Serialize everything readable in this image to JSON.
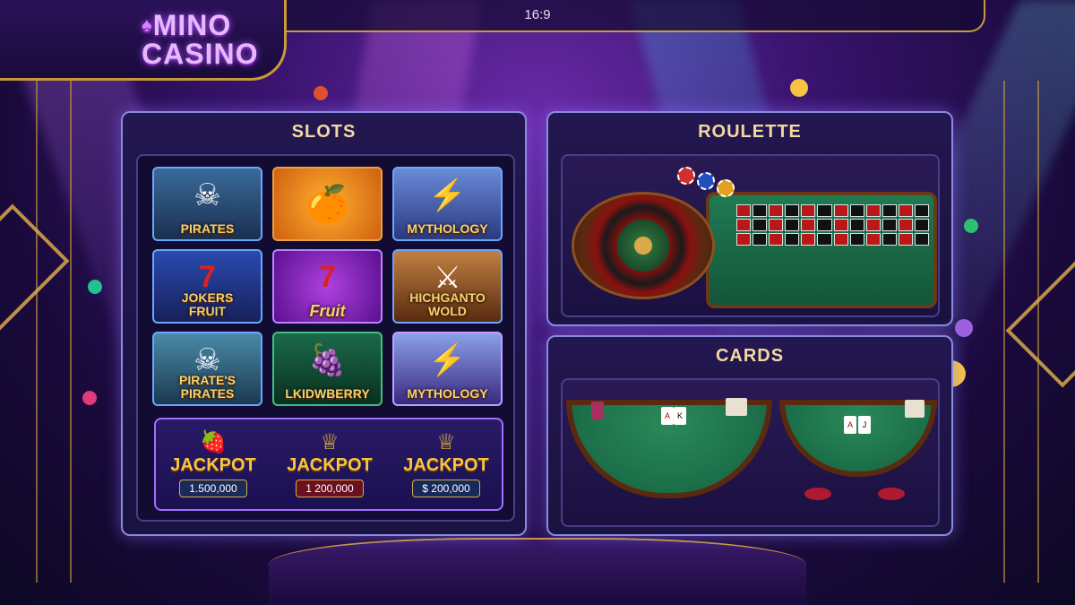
{
  "header": {
    "logo_line1": "MINO",
    "logo_line2": "CASINO",
    "aspect_ratio": "16:9"
  },
  "slots": {
    "title": "SLOTS",
    "games": [
      {
        "label": "PIRATES"
      },
      {
        "label": ""
      },
      {
        "label": "MYTHOLOGY"
      },
      {
        "label": "JOKERS\nFRUIT"
      },
      {
        "label": "Fruit"
      },
      {
        "label": "HICHGANTO\nWOLD"
      },
      {
        "label": "PIRATE'S\nPIRATES"
      },
      {
        "label": "LKIDWBERRY"
      },
      {
        "label": "MYTHOLOGY"
      }
    ],
    "jackpots": [
      {
        "label": "JACKPOT",
        "amount": "1.500,000"
      },
      {
        "label": "JACKPOT",
        "amount": "1 200,000"
      },
      {
        "label": "JACKPOT",
        "amount": "$ 200,000"
      }
    ]
  },
  "roulette": {
    "title": "ROULETTE"
  },
  "cards": {
    "title": "CARDS"
  },
  "colors": {
    "accent_gold": "#f5c542",
    "panel_border": "#8a8ae0",
    "background": "#3a1470"
  }
}
